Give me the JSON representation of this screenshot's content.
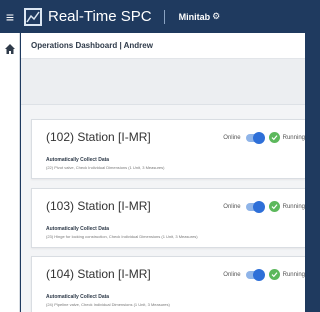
{
  "header": {
    "app_title": "Real-Time SPC",
    "brand": "Minitab"
  },
  "breadcrumb": "Operations Dashboard | Andrew",
  "stations": [
    {
      "name": "(102) Station [I-MR]",
      "online_label": "Online",
      "online": true,
      "status": "Running",
      "collect_title": "Automatically Collect Data",
      "collect_desc": "(22) Pivot valve, Check Individual Dimensions (1 Unit, 3 Measures)"
    },
    {
      "name": "(103) Station [I-MR]",
      "online_label": "Online",
      "online": true,
      "status": "Running",
      "collect_title": "Automatically Collect Data",
      "collect_desc": "(23) Hinge for locking construction, Check Individual Dimensions (1 Unit, 3 Measures)"
    },
    {
      "name": "(104) Station [I-MR]",
      "online_label": "Online",
      "online": true,
      "status": "Running",
      "collect_title": "Automatically Collect Data",
      "collect_desc": "(24) Pipeline valve, Check Individual Dimensions (1 Unit, 3 Measures)"
    }
  ],
  "colors": {
    "navbar": "#1f3a5f",
    "toggle_on": "#2e6fd8",
    "running": "#5cb85c"
  },
  "icons": {
    "menu": "hamburger-menu-icon",
    "logo": "app-logo-icon",
    "home": "home-icon",
    "status": "check-circle-icon"
  }
}
